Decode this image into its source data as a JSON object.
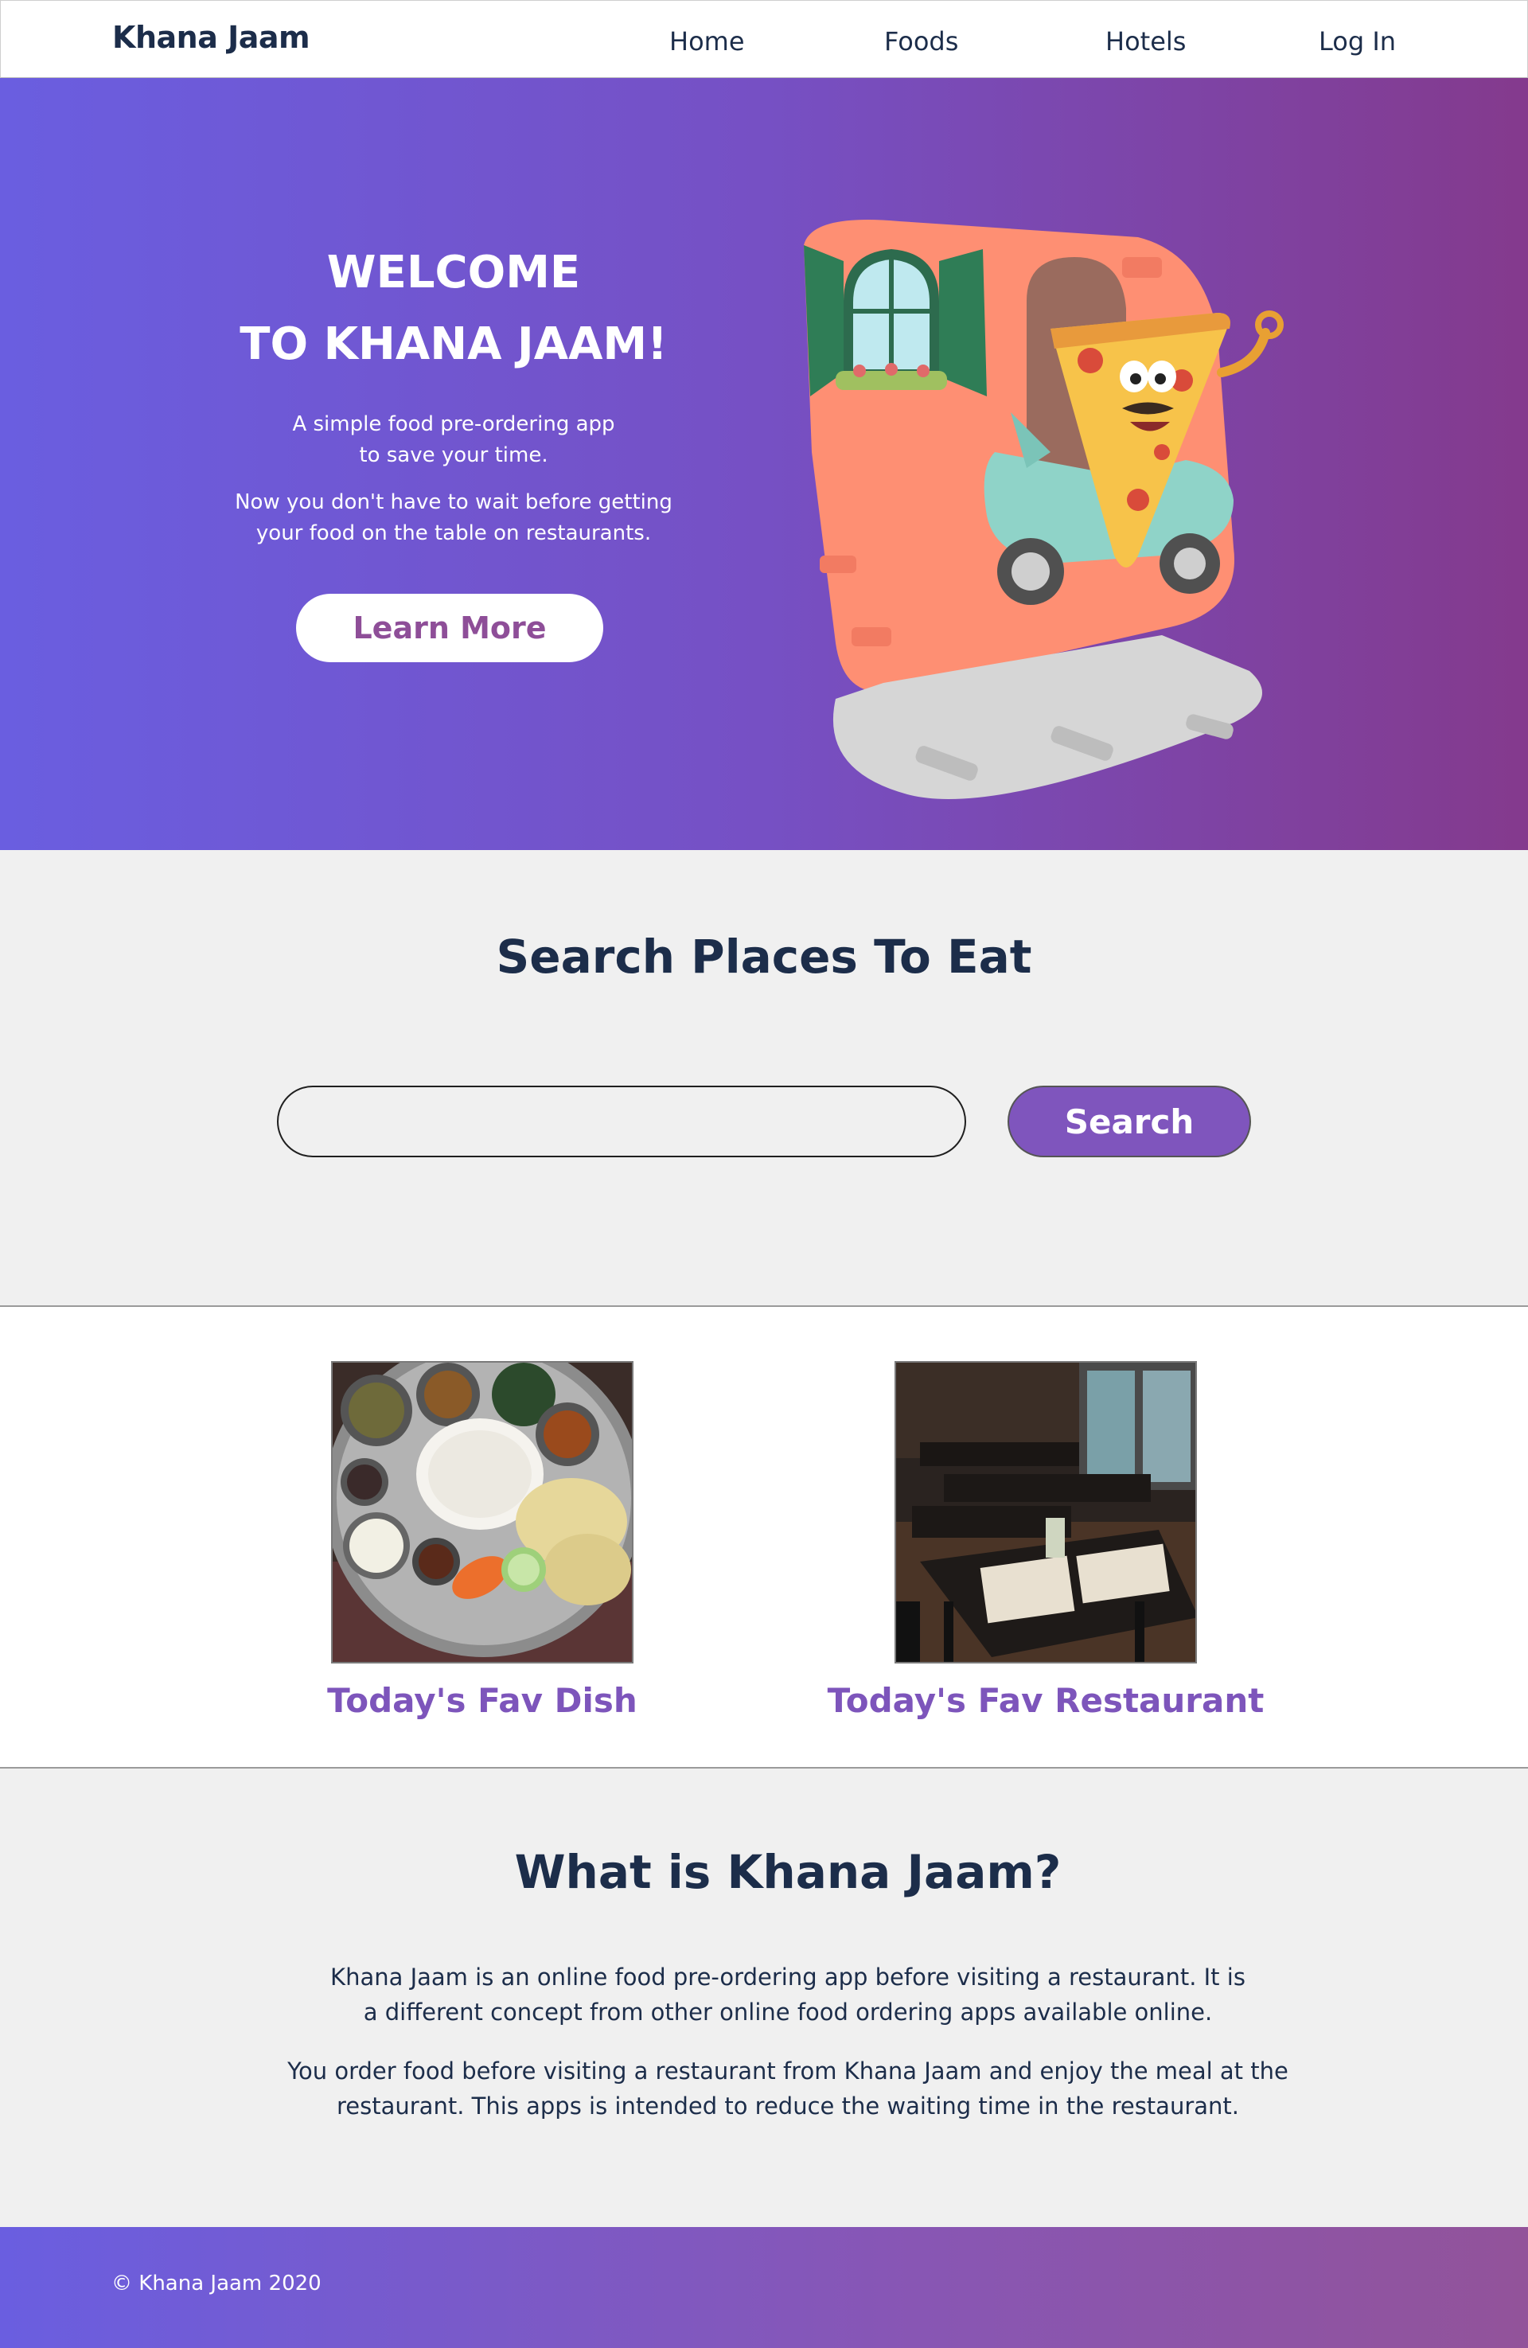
{
  "nav": {
    "brand": "Khana Jaam",
    "links": [
      "Home",
      "Foods",
      "Hotels",
      "Log In"
    ]
  },
  "hero": {
    "title_line1": "WELCOME",
    "title_line2": "TO  KHANA JAAM!",
    "desc1_line1": "A simple food pre-ordering app",
    "desc1_line2": "to save your time.",
    "desc2_line1": "Now you don't have to wait before getting",
    "desc2_line2": "your  food on the table on restaurants.",
    "button": "Learn More"
  },
  "search": {
    "title": "Search Places To Eat",
    "placeholder": "",
    "button": "Search"
  },
  "favorites": {
    "dish_label": "Today's Fav Dish",
    "restaurant_label": "Today's Fav Restaurant"
  },
  "about": {
    "title": "What is Khana Jaam?",
    "p1_line1": "Khana Jaam is an online food pre-ordering app before visiting a restaurant. It is",
    "p1_line2": "a different concept from other online food ordering apps available online.",
    "p2_line1": "You order food before visiting a restaurant from Khana Jaam and enjoy the meal at the",
    "p2_line2": "restaurant. This apps is intended to reduce the waiting time in the restaurant."
  },
  "footer": {
    "copyright": "© Khana Jaam 2020"
  },
  "colors": {
    "hero_gradient_start": "#6a5ee0",
    "hero_gradient_end": "#843a8d",
    "accent_purple": "#7f55bd",
    "heading_navy": "#1c2d4a",
    "section_gray": "#f0f0f0"
  }
}
